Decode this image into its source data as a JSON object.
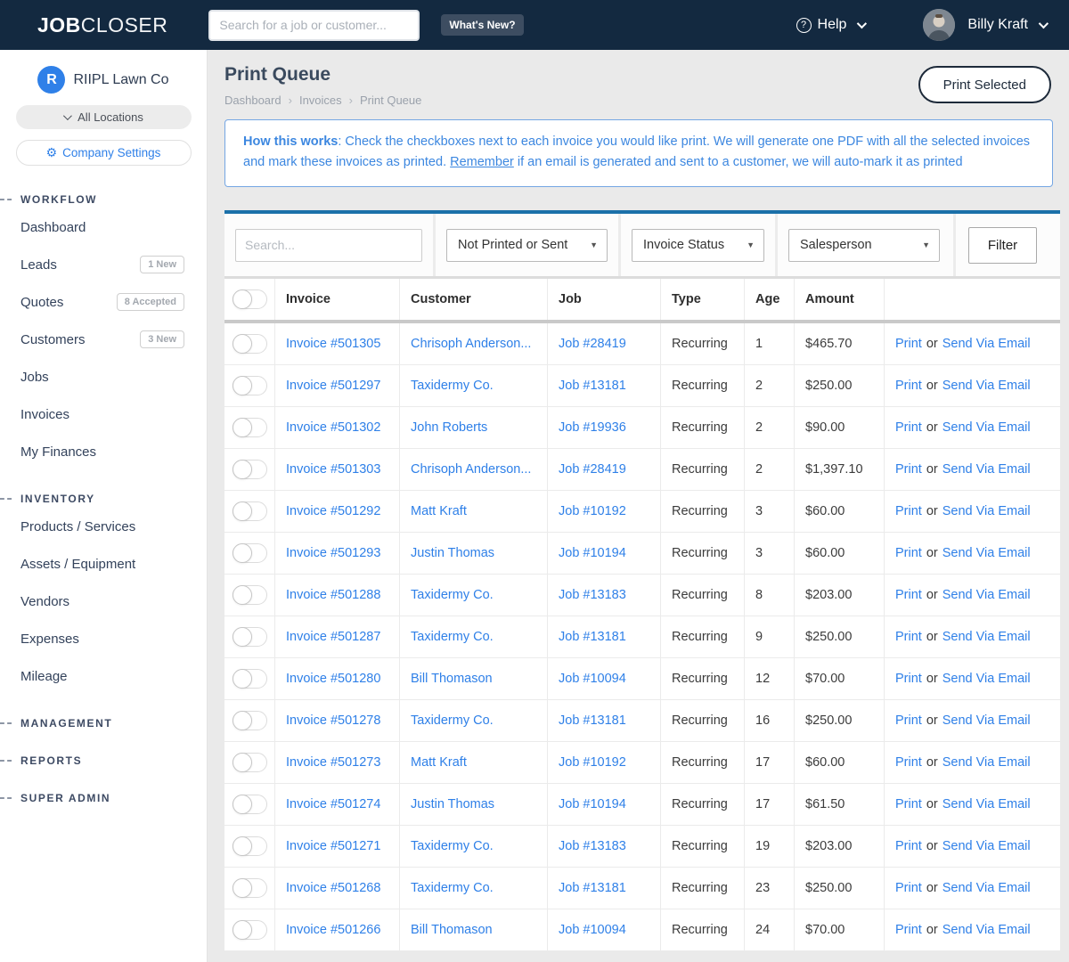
{
  "colors": {
    "accent_blue": "#2f80e8",
    "navbar_bg": "#132940",
    "card_top_bar": "#1b70a9",
    "info_text": "#3c87e0"
  },
  "navbar": {
    "logo_bold": "JOB",
    "logo_light": "CLOSER",
    "search_placeholder": "Search for a job or customer...",
    "whats_new_label": "What's New?",
    "help_label": "Help",
    "user_name": "Billy Kraft"
  },
  "sidebar": {
    "company_initial": "R",
    "company_name": "RIIPL Lawn Co",
    "locations_label": "All Locations",
    "settings_label": "Company Settings",
    "workflow": {
      "header": "WORKFLOW",
      "items": [
        {
          "label": "Dashboard"
        },
        {
          "label": "Leads",
          "badge": "1 New"
        },
        {
          "label": "Quotes",
          "badge": "8 Accepted"
        },
        {
          "label": "Customers",
          "badge": "3 New"
        },
        {
          "label": "Jobs"
        },
        {
          "label": "Invoices"
        },
        {
          "label": "My Finances"
        }
      ]
    },
    "inventory": {
      "header": "INVENTORY",
      "items": [
        {
          "label": "Products / Services"
        },
        {
          "label": "Assets / Equipment"
        },
        {
          "label": "Vendors"
        },
        {
          "label": "Expenses"
        },
        {
          "label": "Mileage"
        }
      ]
    },
    "extra_headers": [
      "MANAGEMENT",
      "REPORTS",
      "SUPER ADMIN"
    ]
  },
  "page": {
    "title": "Print Queue",
    "breadcrumb": [
      "Dashboard",
      "Invoices",
      "Print Queue"
    ],
    "print_selected_label": "Print Selected",
    "info": {
      "lead": "How this works",
      "text_before": ": Check the checkboxes next to each invoice you would like print. We will generate one PDF with all the selected invoices and mark these invoices as printed. ",
      "underlined": "Remember",
      "text_after": " if an email is generated and sent to a customer, we will auto-mark it as printed"
    }
  },
  "filters": {
    "search_placeholder": "Search...",
    "printed_filter": "Not Printed or Sent",
    "status_filter": "Invoice Status",
    "salesperson_filter": "Salesperson",
    "filter_button_label": "Filter"
  },
  "table": {
    "columns": {
      "invoice": "Invoice",
      "customer": "Customer",
      "job": "Job",
      "type": "Type",
      "age": "Age",
      "amount": "Amount"
    },
    "actions": {
      "print": "Print",
      "or": "or",
      "email": "Send Via Email"
    },
    "rows": [
      {
        "invoice": "Invoice #501305",
        "customer": "Chrisoph Anderson...",
        "job": "Job #28419",
        "type": "Recurring",
        "age": "1",
        "amount": "$465.70"
      },
      {
        "invoice": "Invoice #501297",
        "customer": "Taxidermy Co.",
        "job": "Job #13181",
        "type": "Recurring",
        "age": "2",
        "amount": "$250.00"
      },
      {
        "invoice": "Invoice #501302",
        "customer": "John Roberts",
        "job": "Job #19936",
        "type": "Recurring",
        "age": "2",
        "amount": "$90.00"
      },
      {
        "invoice": "Invoice #501303",
        "customer": "Chrisoph Anderson...",
        "job": "Job #28419",
        "type": "Recurring",
        "age": "2",
        "amount": "$1,397.10"
      },
      {
        "invoice": "Invoice #501292",
        "customer": "Matt Kraft",
        "job": "Job #10192",
        "type": "Recurring",
        "age": "3",
        "amount": "$60.00"
      },
      {
        "invoice": "Invoice #501293",
        "customer": "Justin Thomas",
        "job": "Job #10194",
        "type": "Recurring",
        "age": "3",
        "amount": "$60.00"
      },
      {
        "invoice": "Invoice #501288",
        "customer": "Taxidermy Co.",
        "job": "Job #13183",
        "type": "Recurring",
        "age": "8",
        "amount": "$203.00"
      },
      {
        "invoice": "Invoice #501287",
        "customer": "Taxidermy Co.",
        "job": "Job #13181",
        "type": "Recurring",
        "age": "9",
        "amount": "$250.00"
      },
      {
        "invoice": "Invoice #501280",
        "customer": "Bill Thomason",
        "job": "Job #10094",
        "type": "Recurring",
        "age": "12",
        "amount": "$70.00"
      },
      {
        "invoice": "Invoice #501278",
        "customer": "Taxidermy Co.",
        "job": "Job #13181",
        "type": "Recurring",
        "age": "16",
        "amount": "$250.00"
      },
      {
        "invoice": "Invoice #501273",
        "customer": "Matt Kraft",
        "job": "Job #10192",
        "type": "Recurring",
        "age": "17",
        "amount": "$60.00"
      },
      {
        "invoice": "Invoice #501274",
        "customer": "Justin Thomas",
        "job": "Job #10194",
        "type": "Recurring",
        "age": "17",
        "amount": "$61.50"
      },
      {
        "invoice": "Invoice #501271",
        "customer": "Taxidermy Co.",
        "job": "Job #13183",
        "type": "Recurring",
        "age": "19",
        "amount": "$203.00"
      },
      {
        "invoice": "Invoice #501268",
        "customer": "Taxidermy Co.",
        "job": "Job #13181",
        "type": "Recurring",
        "age": "23",
        "amount": "$250.00"
      },
      {
        "invoice": "Invoice #501266",
        "customer": "Bill Thomason",
        "job": "Job #10094",
        "type": "Recurring",
        "age": "24",
        "amount": "$70.00"
      }
    ]
  }
}
